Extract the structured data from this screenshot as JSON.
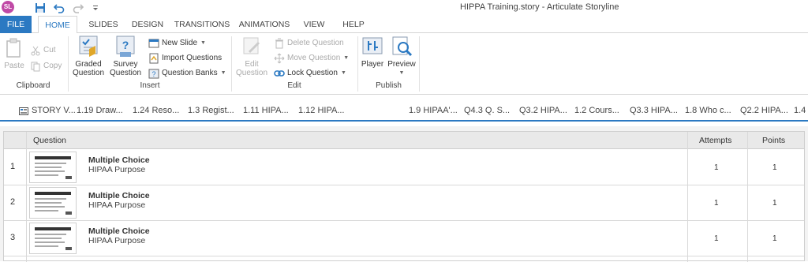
{
  "titlebar": {
    "avatar_initials": "SL",
    "title": "HIPPA Training.story -  Articulate Storyline"
  },
  "tabs": [
    {
      "label": "FILE"
    },
    {
      "label": "HOME"
    },
    {
      "label": "SLIDES"
    },
    {
      "label": "DESIGN"
    },
    {
      "label": "TRANSITIONS"
    },
    {
      "label": "ANIMATIONS"
    },
    {
      "label": "VIEW"
    },
    {
      "label": "HELP"
    }
  ],
  "ribbon": {
    "clipboard": {
      "label": "Clipboard",
      "paste": "Paste",
      "cut": "Cut",
      "copy": "Copy"
    },
    "insert": {
      "label": "Insert",
      "graded_question": [
        "Graded",
        "Question"
      ],
      "survey_question": [
        "Survey",
        "Question"
      ],
      "new_slide": "New Slide",
      "import_questions": "Import Questions",
      "question_banks": "Question Banks"
    },
    "edit": {
      "label": "Edit",
      "edit_question": [
        "Edit",
        "Question"
      ],
      "delete_question": "Delete Question",
      "move_question": "Move Question",
      "lock_question": "Lock Question"
    },
    "publish": {
      "label": "Publish",
      "player": "Player",
      "preview": "Preview"
    }
  },
  "story_tabs": [
    "STORY V...",
    "1.19 Draw...",
    "1.24 Reso...",
    "1.3 Regist...",
    "1.11 HIPA...",
    "1.12 HIPA...",
    "1.9 HIPAA'...",
    "Q4.3 Q. S...",
    "Q3.2 HIPA...",
    "1.2 Cours...",
    "Q3.3 HIPA...",
    "1.8 Who c...",
    "Q2.2 HIPA...",
    "1.4"
  ],
  "grid": {
    "headers": {
      "question": "Question",
      "attempts": "Attempts",
      "points": "Points"
    },
    "rows": [
      {
        "num": "1",
        "type": "Multiple Choice",
        "title": "HIPAA Purpose",
        "attempts": "1",
        "points": "1"
      },
      {
        "num": "2",
        "type": "Multiple Choice",
        "title": "HIPAA Purpose",
        "attempts": "1",
        "points": "1"
      },
      {
        "num": "3",
        "type": "Multiple Choice",
        "title": "HIPAA Purpose",
        "attempts": "1",
        "points": "1"
      }
    ]
  },
  "colors": {
    "accent": "#2b79c2",
    "avatar": "#c04aa6"
  }
}
